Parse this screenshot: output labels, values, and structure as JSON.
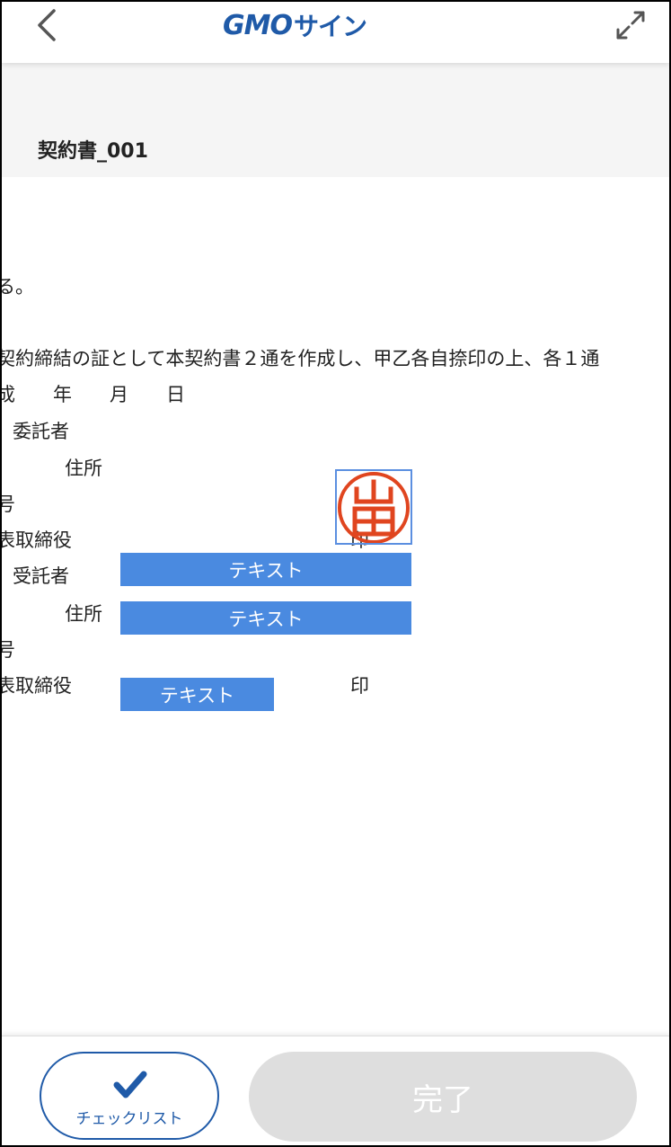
{
  "header": {
    "logo_gmo": "GMO",
    "logo_sign": "サイン"
  },
  "document": {
    "title": "契約書_001",
    "lines": [
      "る。",
      "契約締結の証として本契約書２通を作成し、甲乙各自捺印の上、各１通",
      "成　　年　　月　　日",
      "委託者",
      "住所",
      "号",
      "表取締役",
      "印",
      "受託者",
      "住所",
      "号",
      "表取締役",
      "印"
    ],
    "stamp_char": "山田",
    "fields": [
      {
        "label": "テキスト"
      },
      {
        "label": "テキスト"
      },
      {
        "label": "テキスト"
      }
    ]
  },
  "footer": {
    "checklist_label": "チェックリスト",
    "complete_label": "完了"
  },
  "colors": {
    "brand": "#1f5aa8",
    "field": "#4a8ae0",
    "stamp": "#e0451f",
    "disabled": "#dedede"
  }
}
